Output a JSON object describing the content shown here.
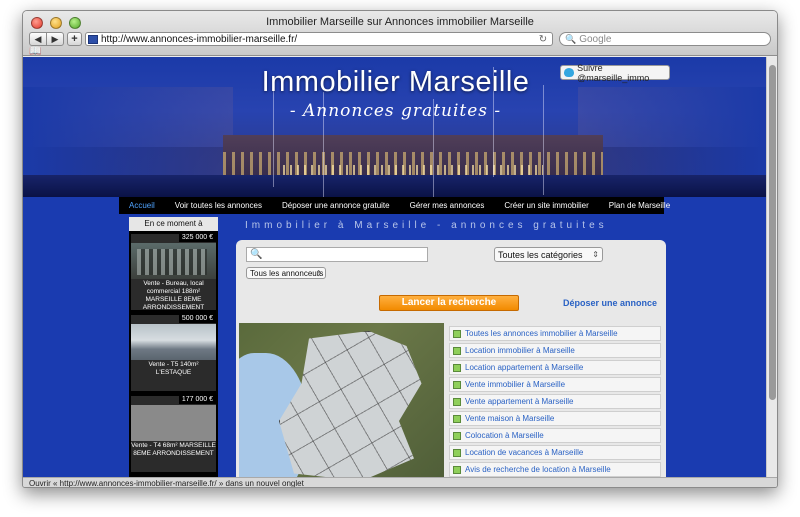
{
  "browser": {
    "window_title": "Immobilier Marseille sur Annonces immobilier Marseille",
    "url": "http://www.annonces-immobilier-marseille.fr/",
    "search_placeholder": "Google",
    "status": "Ouvrir « http://www.annonces-immobilier-marseille.fr/ » dans un nouvel onglet",
    "back_glyph": "◀",
    "forward_glyph": "▶",
    "add_glyph": "+",
    "reload_glyph": "↻",
    "bookmarks_glyph": "📖",
    "search_glyph": "🔍"
  },
  "header": {
    "title": "Immobilier Marseille",
    "subtitle": "- Annonces gratuites -",
    "twitter_label": "Suivre @marseille_immo"
  },
  "menu": [
    "Accueil",
    "Voir toutes les annonces",
    "Déposer une annonce gratuite",
    "Gérer mes annonces",
    "Créer un site immobilier",
    "Plan de Marseille"
  ],
  "sidebar": {
    "title": "En ce moment à Marseille",
    "cards": [
      {
        "price": "325 000 €",
        "desc": "Vente - Bureau, local commercial 188m² MARSEILLE 8EME ARRONDISSEMENT"
      },
      {
        "price": "500 000 €",
        "desc": "Vente - T5 140m² L'ESTAQUE"
      },
      {
        "price": "177 000 €",
        "desc": "Vente - T4 68m² MARSEILLE 8EME ARRONDISSEMENT"
      }
    ]
  },
  "main": {
    "tagline": "Immobilier à Marseille - annonces gratuites",
    "search_icon": "🔍",
    "category_select": "Toutes les catégories",
    "owner_select": "Tous les annonceurs",
    "search_button": "Lancer la recherche",
    "deposit_link": "Déposer une annonce",
    "links": [
      "Toutes les annonces immobilier à Marseille",
      "Location immobilier à Marseille",
      "Location appartement à Marseille",
      "Vente immobilier à Marseille",
      "Vente appartement à Marseille",
      "Vente maison à Marseille",
      "Colocation à Marseille",
      "Location de vacances à Marseille",
      "Avis de recherche de location à Marseille"
    ]
  }
}
